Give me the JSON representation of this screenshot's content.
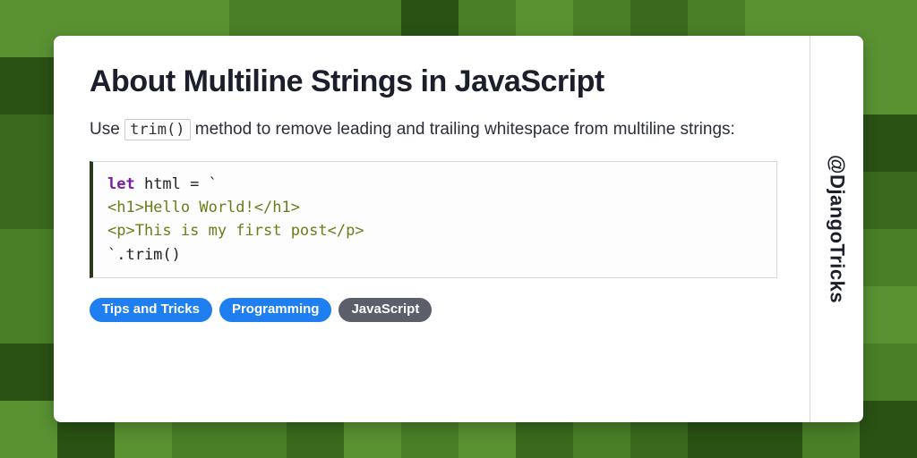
{
  "title": "About Multiline Strings in JavaScript",
  "desc_before": "Use ",
  "desc_code": "trim()",
  "desc_after": " method to remove leading and trailing whitespace from multiline strings:",
  "code": {
    "l1_kw": "let",
    "l1_rest": " html = `",
    "l2": "<h1>Hello World!</h1>",
    "l3": "<p>This is my first post</p>",
    "l4": "`.trim()"
  },
  "tags": {
    "t0": "Tips and Tricks",
    "t1": "Programming",
    "t2": "JavaScript"
  },
  "handle": "@DjangoTricks"
}
